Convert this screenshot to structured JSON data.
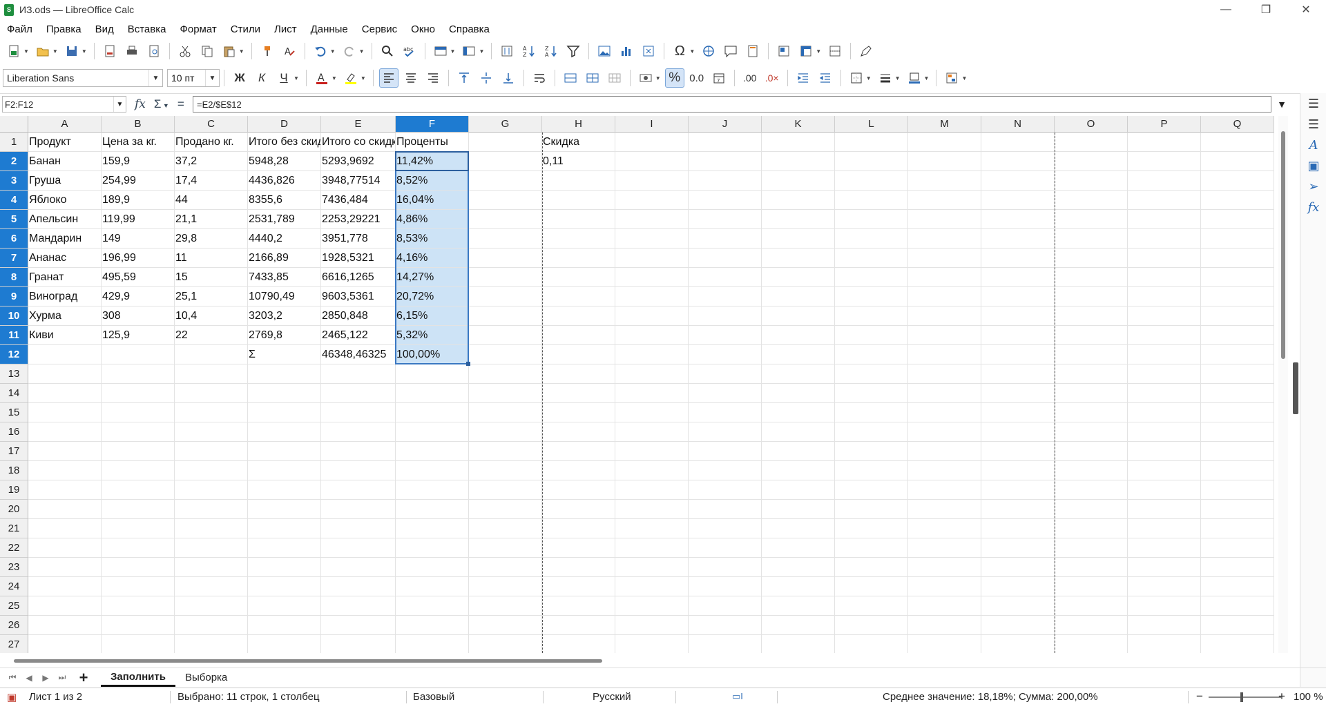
{
  "window": {
    "title": "ИЗ.ods — LibreOffice Calc",
    "app_icon_letter": "S"
  },
  "menu": [
    "Файл",
    "Правка",
    "Вид",
    "Вставка",
    "Формат",
    "Стили",
    "Лист",
    "Данные",
    "Сервис",
    "Окно",
    "Справка"
  ],
  "toolbar": {
    "font_name": "Liberation Sans",
    "font_size": "10 пт",
    "bold": "Ж",
    "italic": "К",
    "underline": "Ч"
  },
  "formula_bar": {
    "name_box": "F2:F12",
    "formula": "=E2/$E$12"
  },
  "columns": [
    "A",
    "B",
    "C",
    "D",
    "E",
    "F",
    "G",
    "H",
    "I",
    "J",
    "K",
    "L",
    "M",
    "N",
    "O",
    "P",
    "Q"
  ],
  "rows": [
    "1",
    "2",
    "3",
    "4",
    "5",
    "6",
    "7",
    "8",
    "9",
    "10",
    "11",
    "12",
    "13",
    "14",
    "15",
    "16",
    "17",
    "18",
    "19",
    "20",
    "21",
    "22",
    "23",
    "24",
    "25",
    "26",
    "27"
  ],
  "cells": [
    [
      "Продукт",
      "Цена за кг.",
      "Продано кг.",
      "Итого без скидки",
      "Итого со скидкой",
      "Проценты",
      "",
      "Скидка"
    ],
    [
      "Банан",
      "159,9",
      "37,2",
      "5948,28",
      "5293,9692",
      "11,42%",
      "",
      "0,11"
    ],
    [
      "Груша",
      "254,99",
      "17,4",
      "4436,826",
      "3948,77514",
      "8,52%",
      "",
      ""
    ],
    [
      "Яблоко",
      "189,9",
      "44",
      "8355,6",
      "7436,484",
      "16,04%",
      "",
      ""
    ],
    [
      "Апельсин",
      "119,99",
      "21,1",
      "2531,789",
      "2253,29221",
      "4,86%",
      "",
      ""
    ],
    [
      "Мандарин",
      "149",
      "29,8",
      "4440,2",
      "3951,778",
      "8,53%",
      "",
      ""
    ],
    [
      "Ананас",
      "196,99",
      "11",
      "2166,89",
      "1928,5321",
      "4,16%",
      "",
      ""
    ],
    [
      "Гранат",
      "495,59",
      "15",
      "7433,85",
      "6616,1265",
      "14,27%",
      "",
      ""
    ],
    [
      "Виноград",
      "429,9",
      "25,1",
      "10790,49",
      "9603,5361",
      "20,72%",
      "",
      ""
    ],
    [
      "Хурма",
      "308",
      "10,4",
      "3203,2",
      "2850,848",
      "6,15%",
      "",
      ""
    ],
    [
      "Киви",
      "125,9",
      "22",
      "2769,8",
      "2465,122",
      "5,32%",
      "",
      ""
    ],
    [
      "",
      "",
      "",
      "Σ",
      "46348,46325",
      "100,00%",
      "",
      ""
    ]
  ],
  "sheets": [
    "Заполнить",
    "Выборка"
  ],
  "status": {
    "sheet_info": "Лист 1 из 2",
    "selection": "Выбрано: 11 строк, 1 столбец",
    "page_style": "Базовый",
    "language": "Русский",
    "summary": "Среднее значение: 18,18%; Сумма: 200,00%",
    "zoom": "100 %",
    "zoom_minus": "−",
    "zoom_plus": "+"
  },
  "colors": {
    "selection_fill": "#cde3f6",
    "header_selected": "#1e7bd1",
    "accent": "#2a6ab5"
  }
}
